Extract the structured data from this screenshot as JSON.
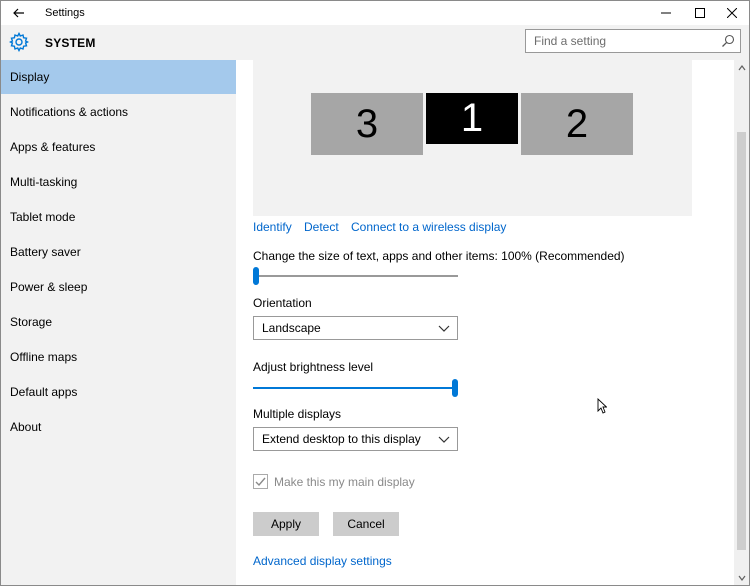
{
  "window": {
    "title": "Settings",
    "back_icon": "arrow-left-icon",
    "minimize_icon": "minimize-icon",
    "maximize_icon": "maximize-icon",
    "close_icon": "close-icon"
  },
  "header": {
    "title": "SYSTEM",
    "icon": "gear-icon",
    "accent_color": "#0078d7"
  },
  "search": {
    "placeholder": "Find a setting",
    "value": "",
    "icon": "search-icon"
  },
  "sidebar": {
    "selected_color": "#a4c9ec",
    "items": [
      {
        "label": "Display",
        "selected": true
      },
      {
        "label": "Notifications & actions",
        "selected": false
      },
      {
        "label": "Apps & features",
        "selected": false
      },
      {
        "label": "Multi-tasking",
        "selected": false
      },
      {
        "label": "Tablet mode",
        "selected": false
      },
      {
        "label": "Battery saver",
        "selected": false
      },
      {
        "label": "Power & sleep",
        "selected": false
      },
      {
        "label": "Storage",
        "selected": false
      },
      {
        "label": "Offline maps",
        "selected": false
      },
      {
        "label": "Default apps",
        "selected": false
      },
      {
        "label": "About",
        "selected": false
      }
    ]
  },
  "display": {
    "monitors": [
      {
        "label": "3",
        "selected": false
      },
      {
        "label": "1",
        "selected": true
      },
      {
        "label": "2",
        "selected": false
      }
    ],
    "links": {
      "identify": "Identify",
      "detect": "Detect",
      "connect_wireless": "Connect to a wireless display"
    },
    "scale": {
      "label": "Change the size of text, apps and other items: 100% (Recommended)",
      "value_fraction": 0.0
    },
    "orientation": {
      "label": "Orientation",
      "value": "Landscape"
    },
    "brightness": {
      "label": "Adjust brightness level",
      "value_fraction": 1.0
    },
    "multiple_displays": {
      "label": "Multiple displays",
      "value": "Extend desktop to this display"
    },
    "main_display": {
      "label": "Make this my main display",
      "checked": true,
      "disabled": true
    },
    "buttons": {
      "apply": "Apply",
      "cancel": "Cancel"
    },
    "advanced_link": "Advanced display settings"
  },
  "link_color": "#0066cc"
}
